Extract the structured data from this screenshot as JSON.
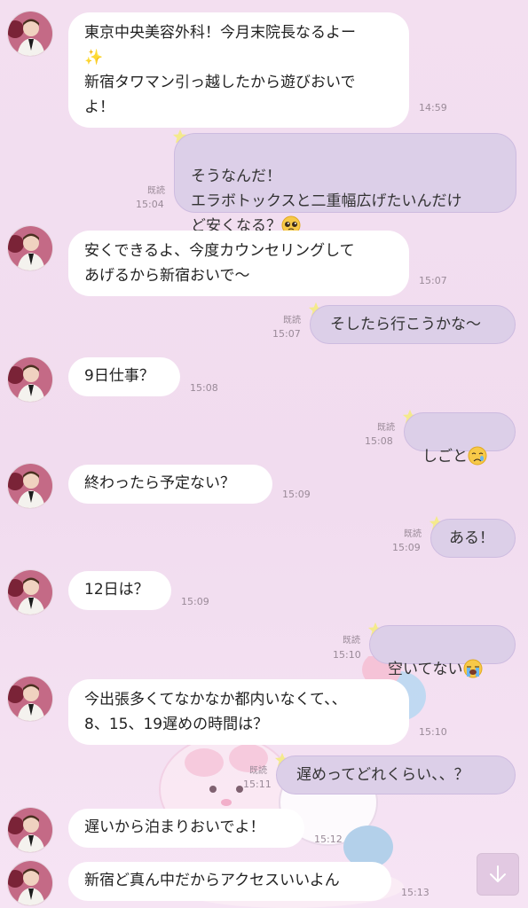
{
  "messages": [
    {
      "side": "in",
      "text": "東京中央美容外科！今月末院長なるよー\n✨\n新宿タワマン引っ越したから遊びおいで\nよ！",
      "time": "14:59"
    },
    {
      "side": "out",
      "text": "そうなんだ！\nエラボトックスと二重幅広げたいんだけ\nど安くなる？",
      "time": "15:04",
      "read": "既読",
      "emoji": "pleading-face"
    },
    {
      "side": "in",
      "text": "安くできるよ、今度カウンセリングして\nあげるから新宿おいで〜",
      "time": "15:07"
    },
    {
      "side": "out",
      "text": "そしたら行こうかな〜",
      "time": "15:07",
      "read": "既読"
    },
    {
      "side": "in",
      "text": "9日仕事？",
      "time": "15:08"
    },
    {
      "side": "out",
      "text": "しごと",
      "time": "15:08",
      "read": "既読",
      "emoji": "crying-face"
    },
    {
      "side": "in",
      "text": "終わったら予定ない？",
      "time": "15:09"
    },
    {
      "side": "out",
      "text": "ある！",
      "time": "15:09",
      "read": "既読"
    },
    {
      "side": "in",
      "text": "12日は？",
      "time": "15:09"
    },
    {
      "side": "out",
      "text": "空いてない",
      "time": "15:10",
      "read": "既読",
      "emoji": "loudly-crying-face"
    },
    {
      "side": "in",
      "text": "今出張多くてなかなか都内いなくて、、\n8、15、19遅めの時間は？",
      "time": "15:10"
    },
    {
      "side": "out",
      "text": "遅めってどれくらい、、？",
      "time": "15:11",
      "read": "既読"
    },
    {
      "side": "in",
      "text": "遅いから泊まりおいでよ！",
      "time": "15:12"
    },
    {
      "side": "in",
      "text": "新宿ど真ん中だからアクセスいいよん",
      "time": "15:13"
    }
  ],
  "icons": {
    "scroll_down": "arrow-down-icon",
    "star": "star-icon",
    "avatar": "contact-avatar"
  },
  "colors": {
    "background": "#f2ddef",
    "incoming_bubble": "#ffffff",
    "outgoing_bubble": "#dccfe8",
    "star": "#f4ea8c"
  }
}
